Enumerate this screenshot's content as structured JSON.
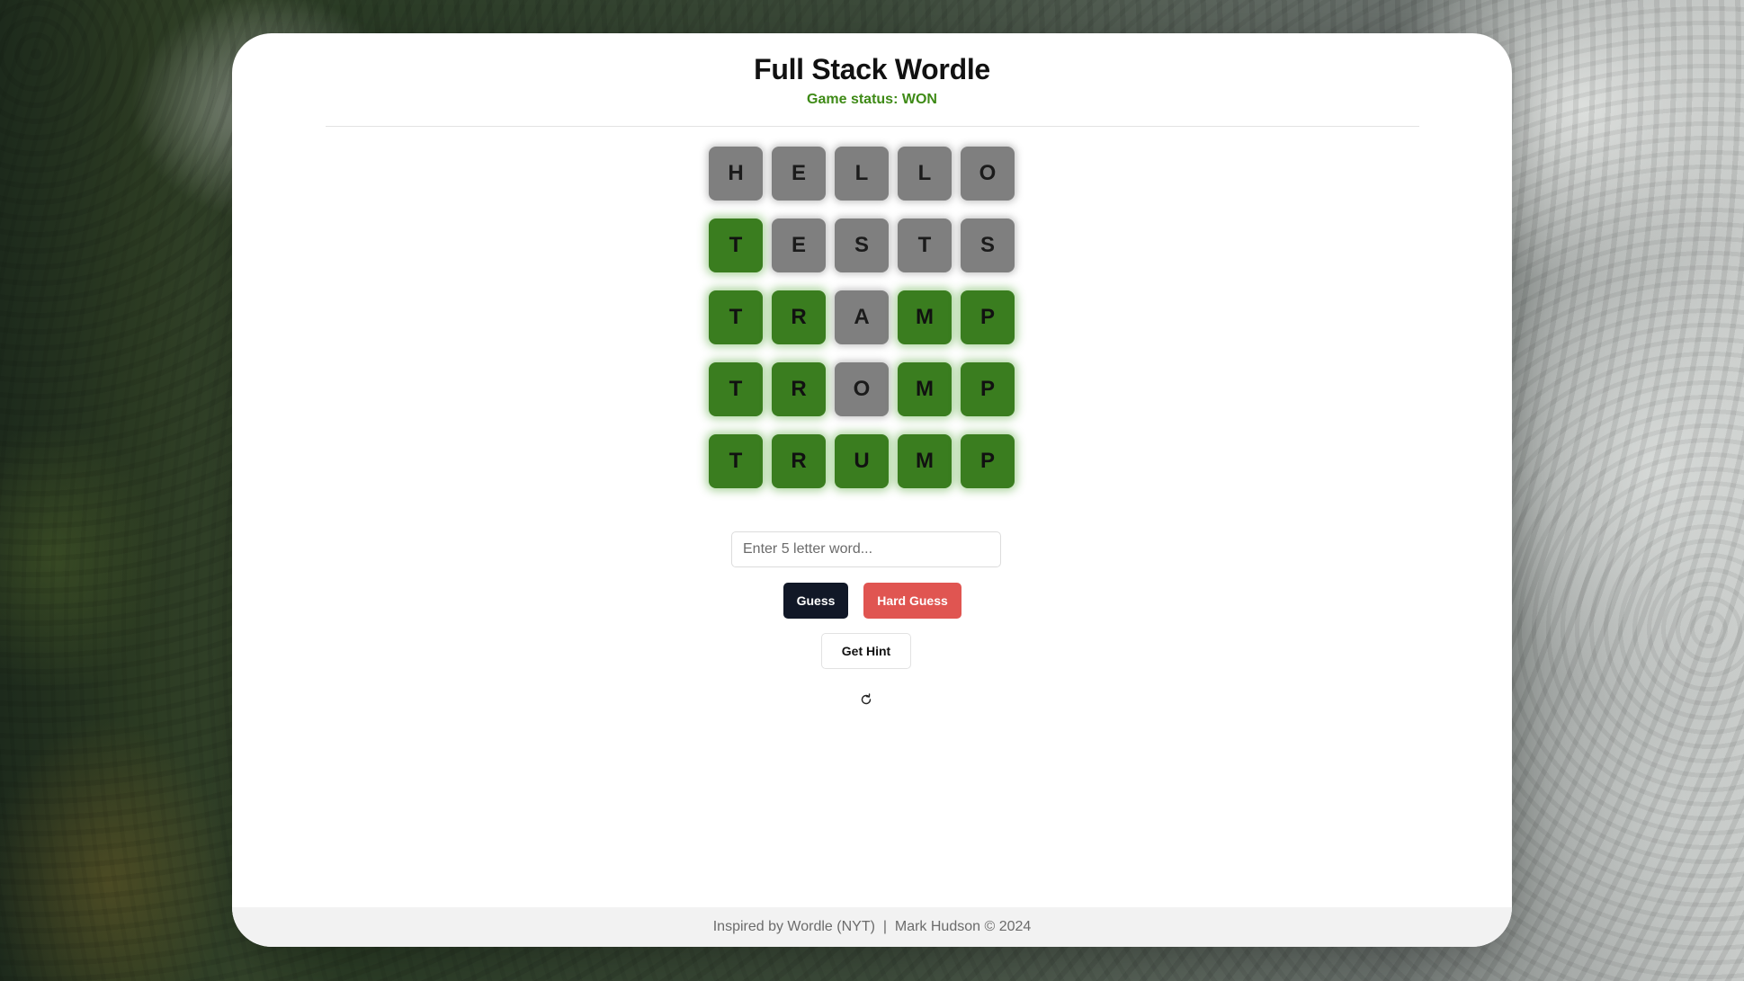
{
  "app": {
    "title": "Full Stack Wordle",
    "status_label": "Game status: WON"
  },
  "colors": {
    "correct": "#3a7d1f",
    "absent": "#7f7f7f",
    "status": "#3e8a16",
    "guess_button": "#111827",
    "hard_guess_button": "#e05551"
  },
  "board": {
    "rows": [
      {
        "letters": [
          "H",
          "E",
          "L",
          "L",
          "O"
        ],
        "states": [
          "absent",
          "absent",
          "absent",
          "absent",
          "absent"
        ]
      },
      {
        "letters": [
          "T",
          "E",
          "S",
          "T",
          "S"
        ],
        "states": [
          "correct",
          "absent",
          "absent",
          "absent",
          "absent"
        ]
      },
      {
        "letters": [
          "T",
          "R",
          "A",
          "M",
          "P"
        ],
        "states": [
          "correct",
          "correct",
          "absent",
          "correct",
          "correct"
        ]
      },
      {
        "letters": [
          "T",
          "R",
          "O",
          "M",
          "P"
        ],
        "states": [
          "correct",
          "correct",
          "absent",
          "correct",
          "correct"
        ]
      },
      {
        "letters": [
          "T",
          "R",
          "U",
          "M",
          "P"
        ],
        "states": [
          "correct",
          "correct",
          "correct",
          "correct",
          "correct"
        ]
      }
    ]
  },
  "input": {
    "value": "",
    "placeholder": "Enter 5 letter word..."
  },
  "buttons": {
    "guess": "Guess",
    "hard_guess": "Hard Guess",
    "hint": "Get Hint"
  },
  "icons": {
    "refresh": "refresh-icon"
  },
  "footer": {
    "text": "Inspired by Wordle (NYT)  |  Mark Hudson © 2024"
  }
}
